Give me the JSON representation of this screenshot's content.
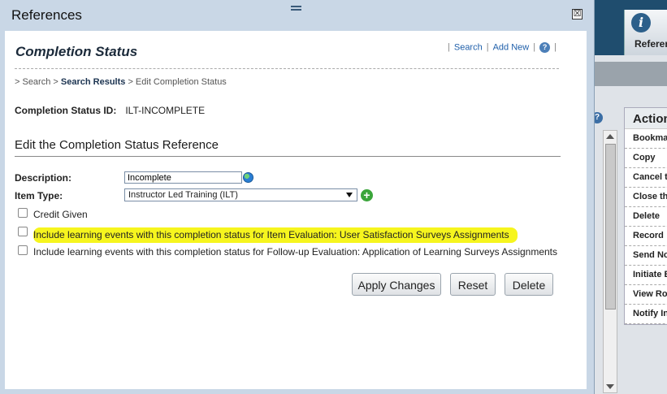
{
  "background": {
    "references_label": "References",
    "actions": {
      "title": "Action",
      "items": [
        "Bookma",
        "Copy",
        "Cancel t",
        "Close th",
        "Delete",
        "Record",
        "Send No",
        "Initiate E",
        "View Ro",
        "Notify In"
      ]
    }
  },
  "dialog": {
    "title": "References",
    "close_glyph": "☒",
    "page_title": "Completion Status",
    "links": {
      "search": "Search",
      "add_new": "Add New",
      "help": "?"
    },
    "breadcrumb": {
      "prefix": "> Search >",
      "results": "Search Results",
      "current": "> Edit Completion Status"
    },
    "id_label": "Completion Status ID:",
    "id_value": "ILT-INCOMPLETE",
    "section_title": "Edit the Completion Status Reference",
    "description_label": "Description:",
    "description_value": "Incomplete",
    "item_type_label": "Item Type:",
    "item_type_value": "Instructor Led Training (ILT)",
    "checkboxes": [
      {
        "label": "Credit Given",
        "checked": false
      },
      {
        "label": "Include learning events with this completion status for Item Evaluation: User Satisfaction Surveys Assignments",
        "checked": false
      },
      {
        "label": "Include learning events with this completion status for Follow-up Evaluation: Application of Learning Surveys Assignments",
        "checked": false
      }
    ],
    "buttons": {
      "apply": "Apply Changes",
      "reset": "Reset",
      "delete": "Delete"
    }
  }
}
